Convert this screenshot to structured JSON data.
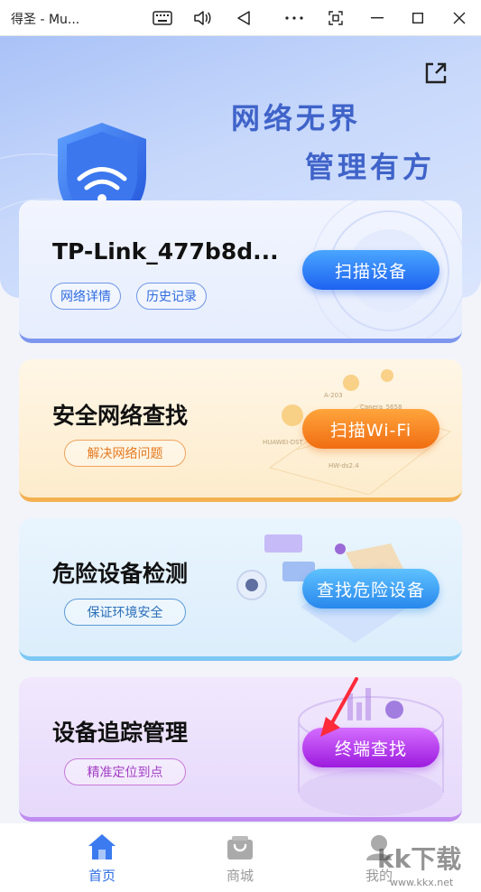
{
  "window": {
    "title": "得圣 - Mu..."
  },
  "banner": {
    "slogan_line1": "网络无界",
    "slogan_line2": "管理有方"
  },
  "cards": {
    "network": {
      "title": "TP-Link_477b8d...",
      "pill1": "网络详情",
      "pill2": "历史记录",
      "button": "扫描设备"
    },
    "wifi": {
      "title": "安全网络查找",
      "pill": "解决网络问题",
      "button": "扫描Wi-Fi",
      "deco_labels": [
        "A-203",
        "Canera_5658",
        "HUAWEI-DST",
        "HW-ds2.4"
      ]
    },
    "danger": {
      "title": "危险设备检测",
      "pill": "保证环境安全",
      "button": "查找危险设备"
    },
    "tracking": {
      "title": "设备追踪管理",
      "pill": "精准定位到点",
      "button": "终端查找"
    }
  },
  "nav": {
    "home": "首页",
    "mall": "商城",
    "mine": "我的"
  },
  "watermark": {
    "text": "kk下载",
    "url": "www.kkx.net"
  },
  "colors": {
    "primary_blue": "#1d62f0",
    "orange": "#f06d12",
    "sky_blue": "#2887ec",
    "purple": "#9c1bde",
    "nav_active": "#2e6ee6",
    "nav_inactive": "#999999"
  },
  "icons": {
    "keyboard": "keyboard-icon",
    "volume": "volume-icon",
    "back": "back-triangle-icon",
    "more": "more-dots-icon",
    "screenshot": "screenshot-icon",
    "minimize": "minimize-icon",
    "maximize": "maximize-icon",
    "close": "close-icon",
    "share": "share-icon",
    "shield": "shield-wifi-icon",
    "home": "home-icon",
    "mall": "shopping-bag-icon",
    "mine": "user-icon"
  }
}
